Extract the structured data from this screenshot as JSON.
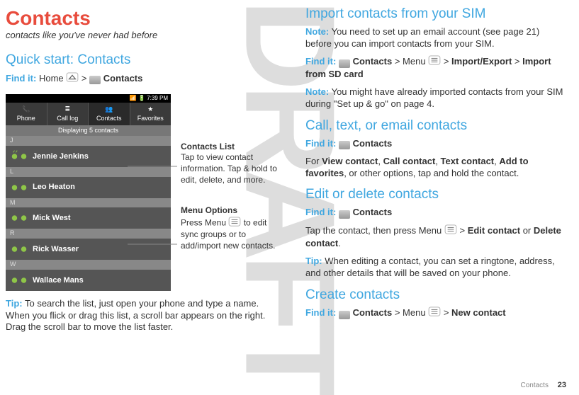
{
  "watermark": "DRAFT",
  "left": {
    "title": "Contacts",
    "subtitle": "contacts like you've never had before",
    "quick_heading": "Quick start: Contacts",
    "findit": "Find it:",
    "home": "Home",
    "sep": ">",
    "contacts_label": "Contacts",
    "tip_label": "Tip:",
    "tip_text": " To search the list, just open your phone and type a name. When you flick or drag this list, a scroll bar appears on the right. Drag the scroll bar to move the list faster.",
    "phone": {
      "time": "7:39 PM",
      "tabs": [
        "Phone",
        "Call log",
        "Contacts",
        "Favorites"
      ],
      "displaying": "Displaying 5 contacts",
      "rows": [
        {
          "letter": "J",
          "name": "Jennie Jenkins"
        },
        {
          "letter": "L",
          "name": "Leo Heaton"
        },
        {
          "letter": "M",
          "name": "Mick West"
        },
        {
          "letter": "R",
          "name": "Rick Wasser"
        },
        {
          "letter": "W",
          "name": "Wallace Mans"
        }
      ]
    },
    "callout1": {
      "title": "Contacts  List",
      "body": "Tap to view contact information. Tap & hold to edit, delete, and more."
    },
    "callout2": {
      "title": "Menu Options",
      "body1": "Press Menu ",
      "body2": " to edit sync groups or to add/import new contacts."
    }
  },
  "right": {
    "h_import": "Import contacts from your SIM",
    "note_label": "Note:",
    "import_note": " You need to set up an email account (see page 21) before you can import contacts from your SIM.",
    "findit": "Find it:",
    "contacts_label": "Contacts",
    "menu_label": "Menu",
    "sep": ">",
    "import_export": "Import/Export",
    "import_sd": "Import from SD card",
    "import_note2": " You might have already imported contacts from your SIM during \"Set up & go\" on page 4.",
    "h_cte": "Call, text, or email contacts",
    "cte_body1": "For ",
    "cte_b1": "View contact",
    "cte_s1": ", ",
    "cte_b2": "Call contact",
    "cte_s2": ", ",
    "cte_b3": "Text contact",
    "cte_s3": ", ",
    "cte_b4": "Add to favorites",
    "cte_body2": ", or other options, tap and hold the contact.",
    "h_edit": "Edit or delete contacts",
    "edit_body1": "Tap the contact, then press Menu ",
    "edit_b1": "Edit contact",
    "edit_s1": " or ",
    "edit_b2": "Delete contact",
    "edit_s2": ".",
    "tip_label": "Tip:",
    "edit_tip": " When editing a contact, you can set a ringtone, address, and other details that will be saved on your phone.",
    "h_create": "Create contacts",
    "create_b1": "New contact"
  },
  "footer": {
    "section": "Contacts",
    "page": "23"
  }
}
